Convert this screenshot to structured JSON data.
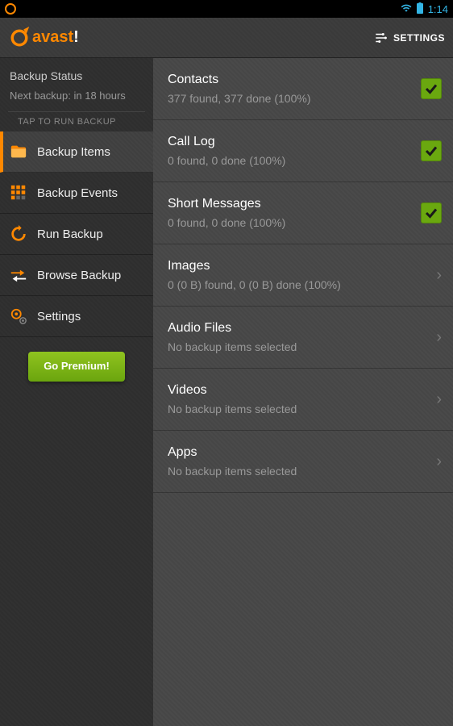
{
  "status_bar": {
    "time": "1:14"
  },
  "header": {
    "brand_prefix": "avast",
    "brand_suffix": "!",
    "settings_label": "SETTINGS"
  },
  "sidebar": {
    "status_title": "Backup Status",
    "status_subtitle": "Next backup: in 18 hours",
    "tap_label": "TAP TO RUN BACKUP",
    "items": [
      {
        "label": "Backup Items"
      },
      {
        "label": "Backup Events"
      },
      {
        "label": "Run Backup"
      },
      {
        "label": "Browse Backup"
      },
      {
        "label": "Settings"
      }
    ],
    "premium_label": "Go Premium!"
  },
  "content": {
    "items": [
      {
        "label": "Contacts",
        "status": "377 found, 377 done (100%)",
        "checked": true
      },
      {
        "label": "Call Log",
        "status": "0 found, 0 done (100%)",
        "checked": true
      },
      {
        "label": "Short Messages",
        "status": "0 found, 0 done (100%)",
        "checked": true
      },
      {
        "label": "Images",
        "status": "0 (0 B) found, 0 (0 B) done (100%)",
        "chevron": true
      },
      {
        "label": "Audio Files",
        "status": "No backup items selected",
        "chevron": true
      },
      {
        "label": "Videos",
        "status": "No backup items selected",
        "chevron": true
      },
      {
        "label": "Apps",
        "status": "No backup items selected",
        "chevron": true
      }
    ]
  }
}
